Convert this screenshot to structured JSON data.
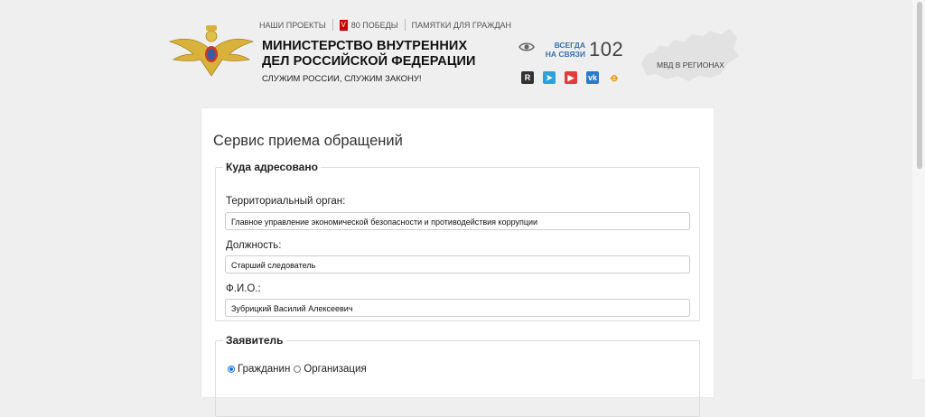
{
  "topnav": {
    "projects": "НАШИ ПРОЕКТЫ",
    "victory": "80 ПОБЕДЫ",
    "reminders": "ПАМЯТКИ ДЛЯ ГРАЖДАН"
  },
  "header": {
    "title": "МИНИСТЕРСТВО ВНУТРЕННИХ ДЕЛ РОССИЙСКОЙ ФЕДЕРАЦИИ",
    "motto": "СЛУЖИМ РОССИИ, СЛУЖИМ ЗАКОНУ!",
    "always_line1": "ВСЕГДА",
    "always_line2": "НА СВЯЗИ",
    "hotline": "102",
    "regions": "МВД В РЕГИОНАХ",
    "social_icons": [
      "rutube-icon",
      "telegram-icon",
      "youtube-icon",
      "vk-icon",
      "ok-icon"
    ]
  },
  "form": {
    "title": "Сервис приема обращений",
    "addressee": {
      "legend": "Куда адресовано",
      "org_label": "Территориальный орган:",
      "org_value": "Главное управление экономической безопасности и противодействия коррупции",
      "position_label": "Должность:",
      "position_value": "Старший следователь",
      "name_label": "Ф.И.О.:",
      "name_value": "Зубрицкий Василий Алексеевич"
    },
    "applicant": {
      "legend": "Заявитель",
      "option_citizen": "Гражданин",
      "option_org": "Организация",
      "selected": "Гражданин"
    }
  },
  "colors": {
    "accent": "#3a6fb0",
    "radio": "#1a73e8"
  }
}
